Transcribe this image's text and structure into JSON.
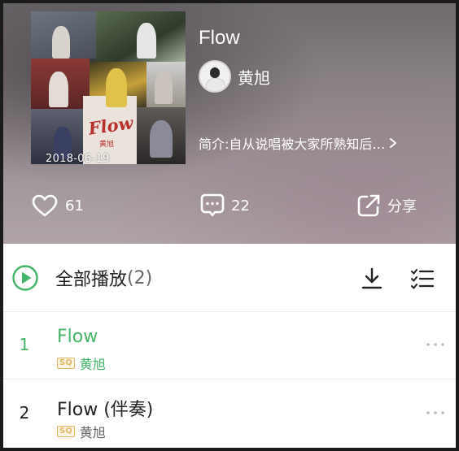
{
  "album": {
    "title": "Flow",
    "date": "2018-06-19",
    "cover_logo_text": "Flow",
    "cover_logo_sub": "黄旭",
    "artist_name": "黄旭",
    "intro": "简介:自从说唱被大家所熟知后…"
  },
  "actions": {
    "likes": "61",
    "comments": "22",
    "share_label": "分享"
  },
  "play_all": {
    "label": "全部播放",
    "count": "(2)"
  },
  "songs": [
    {
      "index": "1",
      "title": "Flow",
      "quality": "SQ",
      "artist": "黄旭",
      "active": true
    },
    {
      "index": "2",
      "title": "Flow (伴奏)",
      "quality": "SQ",
      "artist": "黄旭",
      "active": false
    }
  ],
  "colors": {
    "accent": "#43b468",
    "sq_badge": "#e2b865",
    "text_primary": "#222222",
    "text_secondary": "#666666"
  },
  "icons": {
    "like": "heart-icon",
    "comment": "comment-icon",
    "share": "share-icon",
    "play_all": "play-circle-icon",
    "download": "download-icon",
    "multi_select": "multi-select-icon",
    "more": "more-icon",
    "intro_more": "chevron-right-icon"
  }
}
